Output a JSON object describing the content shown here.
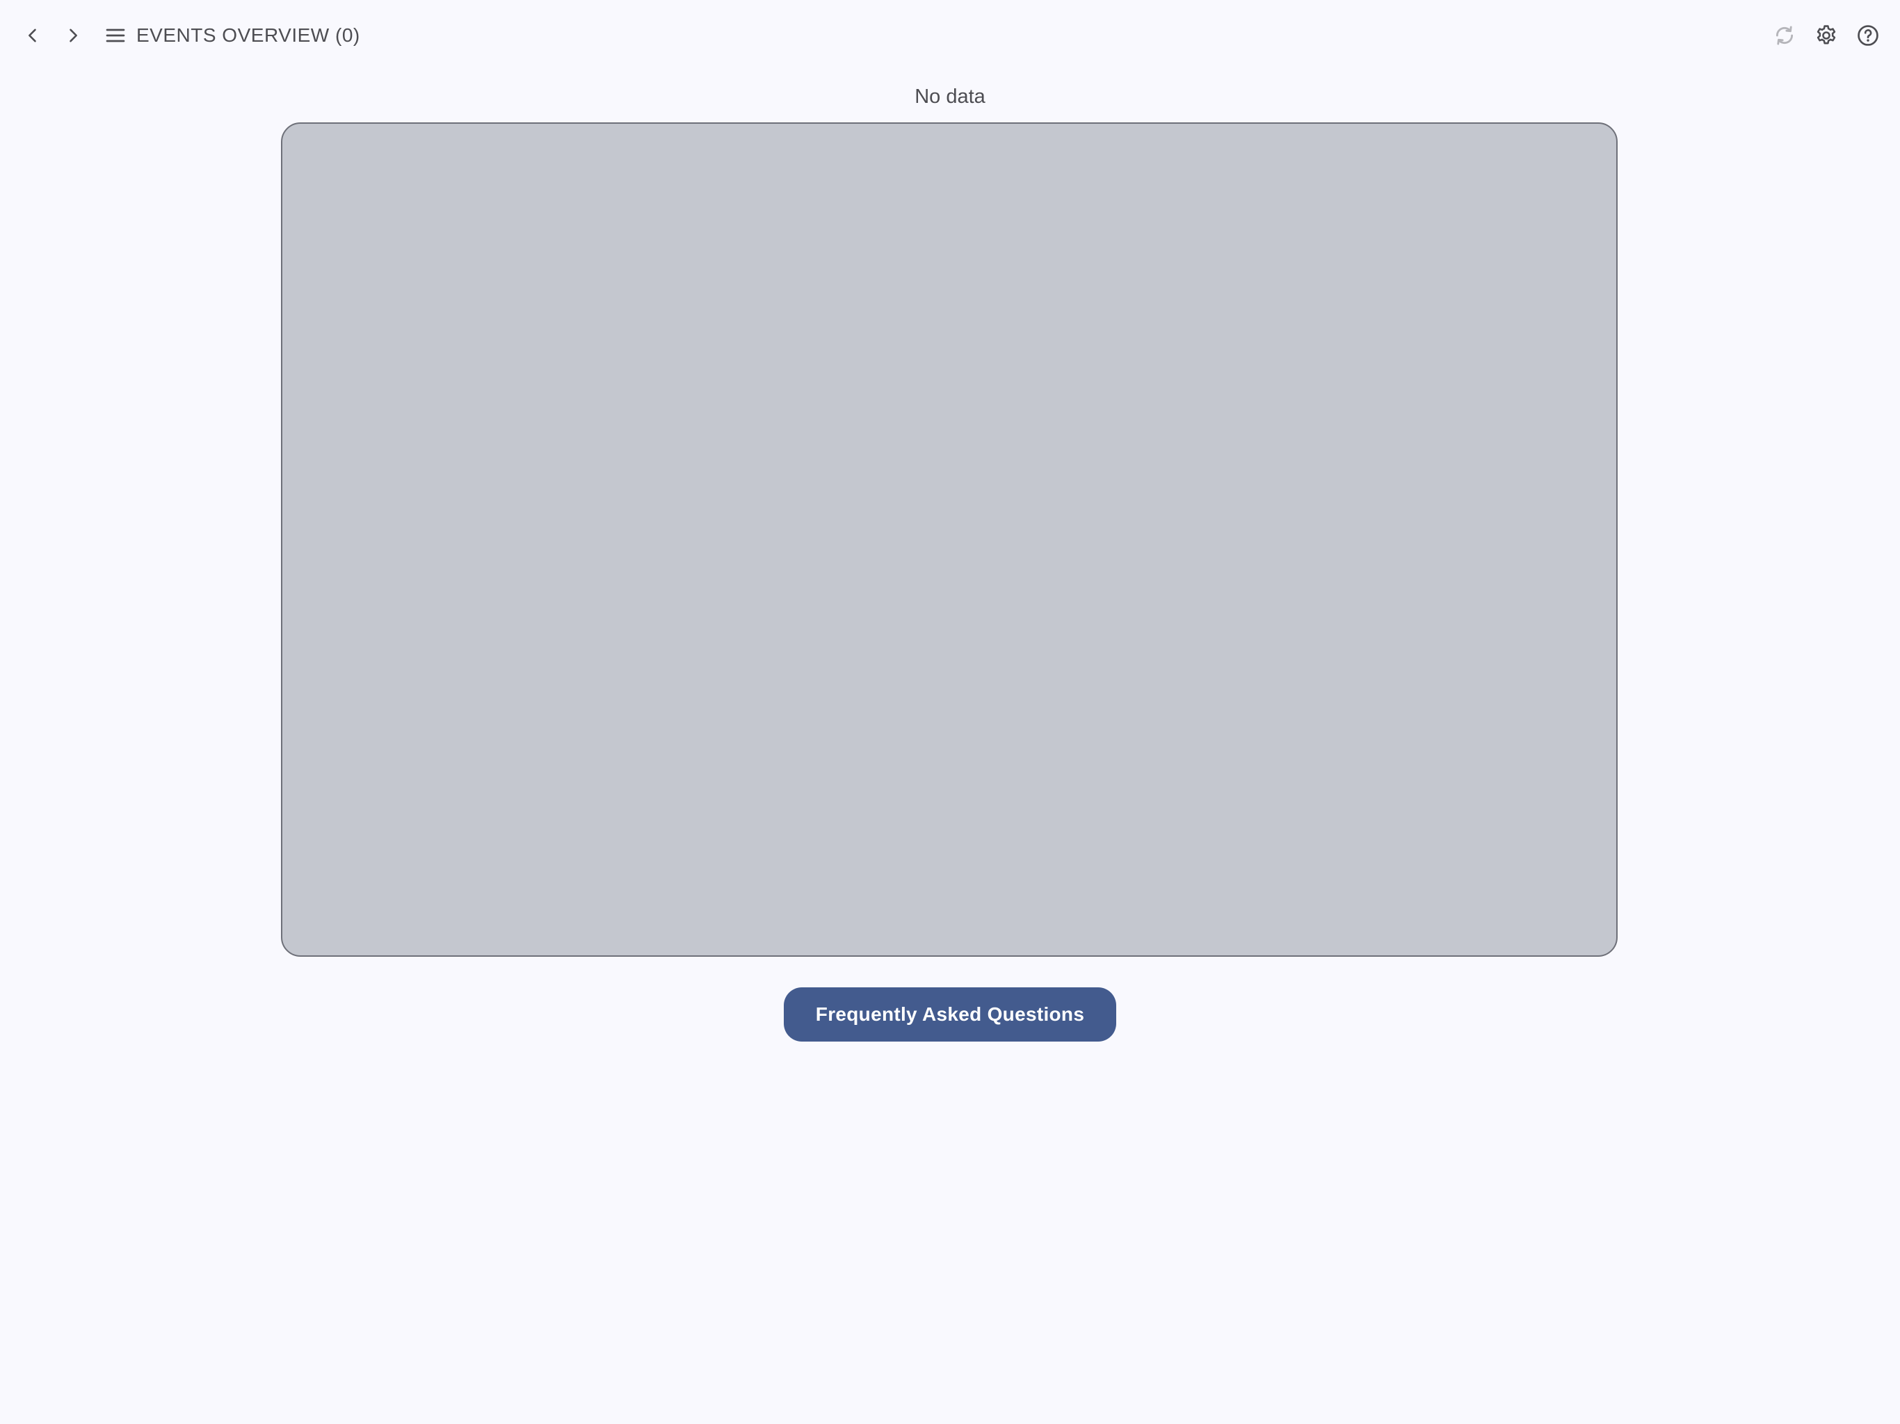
{
  "header": {
    "title": "EVENTS OVERVIEW (0)",
    "left_icons": [
      "chevron-left-icon",
      "chevron-right-icon",
      "menu-icon"
    ],
    "right_icons": [
      "refresh-icon",
      "gear-icon",
      "help-icon"
    ]
  },
  "main": {
    "status_text": "No data",
    "faq_button_label": "Frequently Asked Questions"
  },
  "colors": {
    "background": "#f9f9fe",
    "panel_fill": "#c4c7cf",
    "panel_border": "#6e7079",
    "button_fill": "#435b8e",
    "button_text": "#ffffff",
    "icon_color": "#4d4d52",
    "refresh_icon_disabled": "#b5b5ba"
  }
}
